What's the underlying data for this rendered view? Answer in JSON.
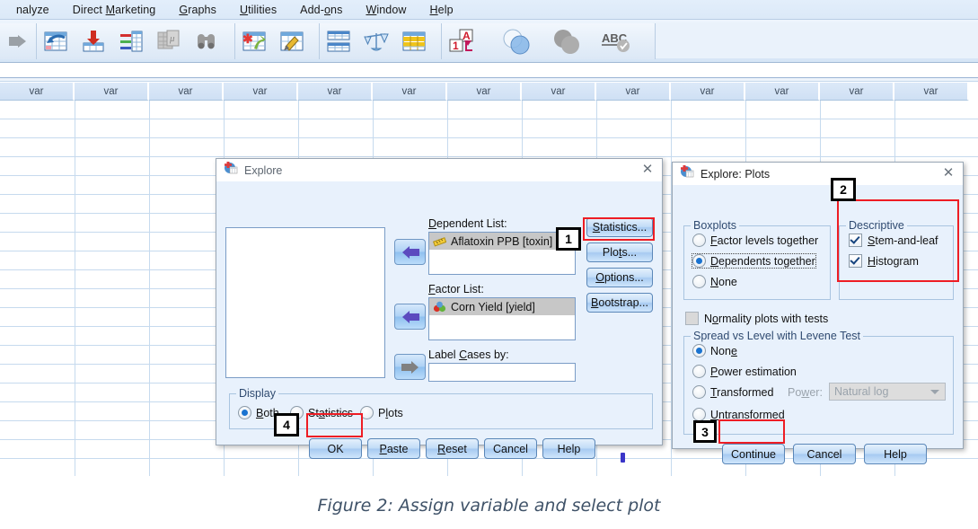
{
  "menubar": {
    "items": [
      {
        "label": "nalyze",
        "accel": ""
      },
      {
        "label": "Direct Marketing",
        "accel": "M"
      },
      {
        "label": "Graphs",
        "accel": "G"
      },
      {
        "label": "Utilities",
        "accel": "U"
      },
      {
        "label": "Add-ons",
        "accel": "o"
      },
      {
        "label": "Window",
        "accel": "W"
      },
      {
        "label": "Help",
        "accel": "H"
      }
    ]
  },
  "toolbar": {
    "icons": [
      "open-file-icon",
      "recall-dialog-icon",
      "save-file-icon",
      "print-icon",
      "export-icon",
      "find-icon",
      "insert-case-icon",
      "insert-variable-icon",
      "split-file-icon",
      "weight-cases-icon",
      "select-cases-icon",
      "value-labels-icon",
      "use-variable-sets-icon",
      "show-all-variables-icon",
      "spell-check-icon"
    ]
  },
  "grid": {
    "column_label": "var",
    "column_count": 13,
    "row_count": 20
  },
  "explore_dialog": {
    "title": "Explore",
    "close_label": "✕",
    "source_list_items": [],
    "dependent_list": {
      "label": "Dependent List:",
      "accel": "D",
      "items": [
        {
          "text": "Aflatoxin PPB [toxin]",
          "icon": "ruler-scale-icon",
          "selected": true
        }
      ]
    },
    "factor_list": {
      "label": "Factor List:",
      "accel": "F",
      "items": [
        {
          "text": "Corn Yield [yield]",
          "icon": "nominal-variable-icon",
          "selected": true
        }
      ]
    },
    "label_cases": {
      "label": "Label Cases by:",
      "accel": "C",
      "value": ""
    },
    "side_buttons": [
      {
        "label": "Statistics...",
        "accel": "S",
        "name": "statistics-button",
        "highlighted": false
      },
      {
        "label": "Plots...",
        "accel": "t",
        "name": "plots-button",
        "highlighted": true
      },
      {
        "label": "Options...",
        "accel": "O",
        "name": "options-button",
        "highlighted": false
      },
      {
        "label": "Bootstrap...",
        "accel": "B",
        "name": "bootstrap-button",
        "highlighted": false
      }
    ],
    "display_group": {
      "title": "Display",
      "options": [
        {
          "label": "Both",
          "accel": "B",
          "selected": true
        },
        {
          "label": "Statistics",
          "accel": "a",
          "selected": false
        },
        {
          "label": "Plots",
          "accel": "l",
          "selected": false
        }
      ]
    },
    "action_buttons": [
      {
        "label": "OK",
        "accel": "",
        "name": "ok-button",
        "highlighted": true
      },
      {
        "label": "Paste",
        "accel": "P",
        "name": "paste-button",
        "highlighted": false
      },
      {
        "label": "Reset",
        "accel": "R",
        "name": "reset-button",
        "highlighted": false
      },
      {
        "label": "Cancel",
        "accel": "",
        "name": "cancel-button",
        "highlighted": false
      },
      {
        "label": "Help",
        "accel": "",
        "name": "help-button",
        "highlighted": false
      }
    ]
  },
  "plots_dialog": {
    "title": "Explore: Plots",
    "close_label": "✕",
    "boxplots_group": {
      "title": "Boxplots",
      "options": [
        {
          "label": "Factor levels together",
          "accel": "F",
          "selected": false
        },
        {
          "label": "Dependents together",
          "accel": "D",
          "selected": true
        },
        {
          "label": "None",
          "accel": "N",
          "selected": false
        }
      ]
    },
    "descriptive_group": {
      "title": "Descriptive",
      "options": [
        {
          "label": "Stem-and-leaf",
          "accel": "S",
          "checked": true
        },
        {
          "label": "Histogram",
          "accel": "H",
          "checked": true
        }
      ]
    },
    "normality_checkbox": {
      "label": "Normality plots with tests",
      "accel": "o",
      "checked": false
    },
    "spread_group": {
      "title": "Spread vs Level with Levene Test",
      "options": [
        {
          "label": "None",
          "accel": "e",
          "selected": true,
          "disabled": false
        },
        {
          "label": "Power estimation",
          "accel": "P",
          "selected": false,
          "disabled": false
        },
        {
          "label": "Transformed",
          "accel": "T",
          "selected": false,
          "disabled": false
        },
        {
          "label": "Untransformed",
          "accel": "U",
          "selected": false,
          "disabled": false
        }
      ],
      "power_label": "Power:",
      "power_accel": "w",
      "power_value": "Natural log",
      "power_disabled": true
    },
    "action_buttons": [
      {
        "label": "Continue",
        "name": "continue-button",
        "highlighted": true
      },
      {
        "label": "Cancel",
        "name": "cancel-button",
        "highlighted": false
      },
      {
        "label": "Help",
        "name": "help-button",
        "highlighted": false
      }
    ]
  },
  "annotations": {
    "badges": [
      {
        "number": "1",
        "target": "plots-button"
      },
      {
        "number": "2",
        "target": "descriptive-group"
      },
      {
        "number": "3",
        "target": "continue-button"
      },
      {
        "number": "4",
        "target": "ok-button"
      }
    ],
    "highlight_color": "#ee1d24"
  },
  "caption": {
    "text": "Figure 2: Assign variable and select plot"
  }
}
